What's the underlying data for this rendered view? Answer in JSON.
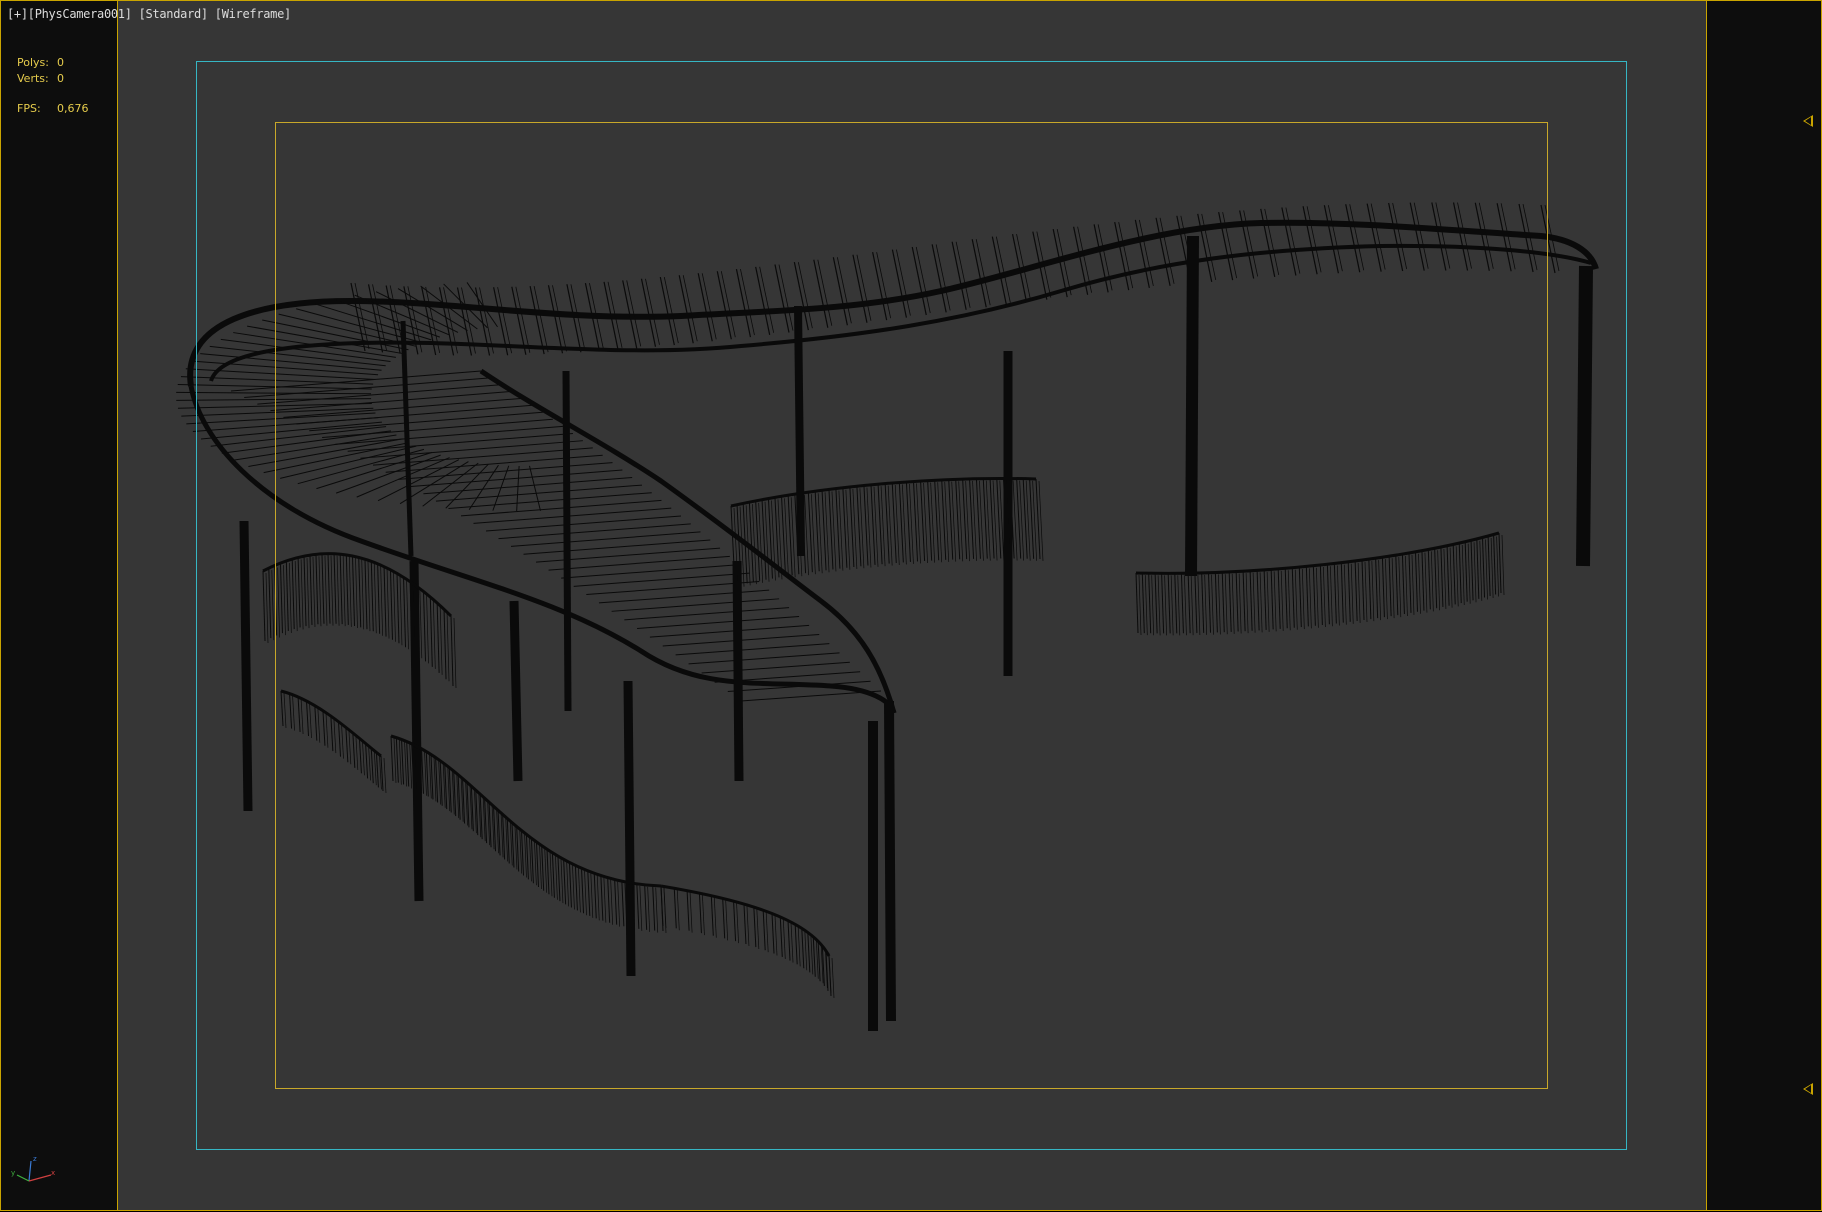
{
  "viewport": {
    "label": {
      "menu": "[+]",
      "camera": "[PhysCamera001]",
      "shading_preset": "[Standard]",
      "render_mode": "[Wireframe]"
    },
    "stats": {
      "polys_label": "Polys:",
      "polys_value": "0",
      "verts_label": "Verts:",
      "verts_value": "0",
      "fps_label": "FPS:",
      "fps_value": "0,676"
    },
    "colors": {
      "viewport_bg": "#363636",
      "outer_bg": "#0d0d0d",
      "active_border": "#c9a400",
      "safe_frame_outer": "#36b6c4",
      "safe_frame_inner": "#c8a82a",
      "stats_text": "#e6cc4c",
      "wireframe": "#0a0a0a"
    },
    "icons": {
      "axis_gizmo": "axis-tripod-icon",
      "frame_markers": "triangle-marker-icon"
    }
  }
}
